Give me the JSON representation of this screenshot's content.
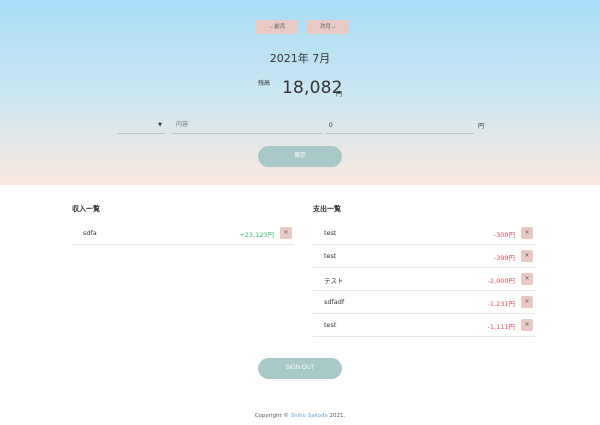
{
  "nav": {
    "prev_label": "←前月",
    "next_label": "次月→"
  },
  "month_title": "2021年 7月",
  "balance": {
    "label": "残高",
    "value": "18,082",
    "unit": "円"
  },
  "form": {
    "content_placeholder": "内容",
    "amount_value": "0",
    "amount_unit": "円",
    "save_label": "保存"
  },
  "income": {
    "title": "収入一覧",
    "items": [
      {
        "label": "sdfa",
        "amount": "+23,123円"
      }
    ]
  },
  "expense": {
    "title": "支出一覧",
    "items": [
      {
        "label": "test",
        "amount": "-300円"
      },
      {
        "label": "test",
        "amount": "-399円"
      },
      {
        "label": "テスト",
        "amount": "-2,000円"
      },
      {
        "label": "sdfadf",
        "amount": "-1,231円"
      },
      {
        "label": "test",
        "amount": "-1,111円"
      }
    ]
  },
  "delete_label": "×",
  "sign_out_label": "SIGN OUT",
  "footer": {
    "prefix": "Copyright © ",
    "owner": "Shiho Sakoda",
    "suffix": " 2021."
  },
  "colors": {
    "income": "#3dbe7a",
    "expense": "#e55060",
    "button": "#a9c9c9",
    "nav_button": "#e8c9c3"
  }
}
